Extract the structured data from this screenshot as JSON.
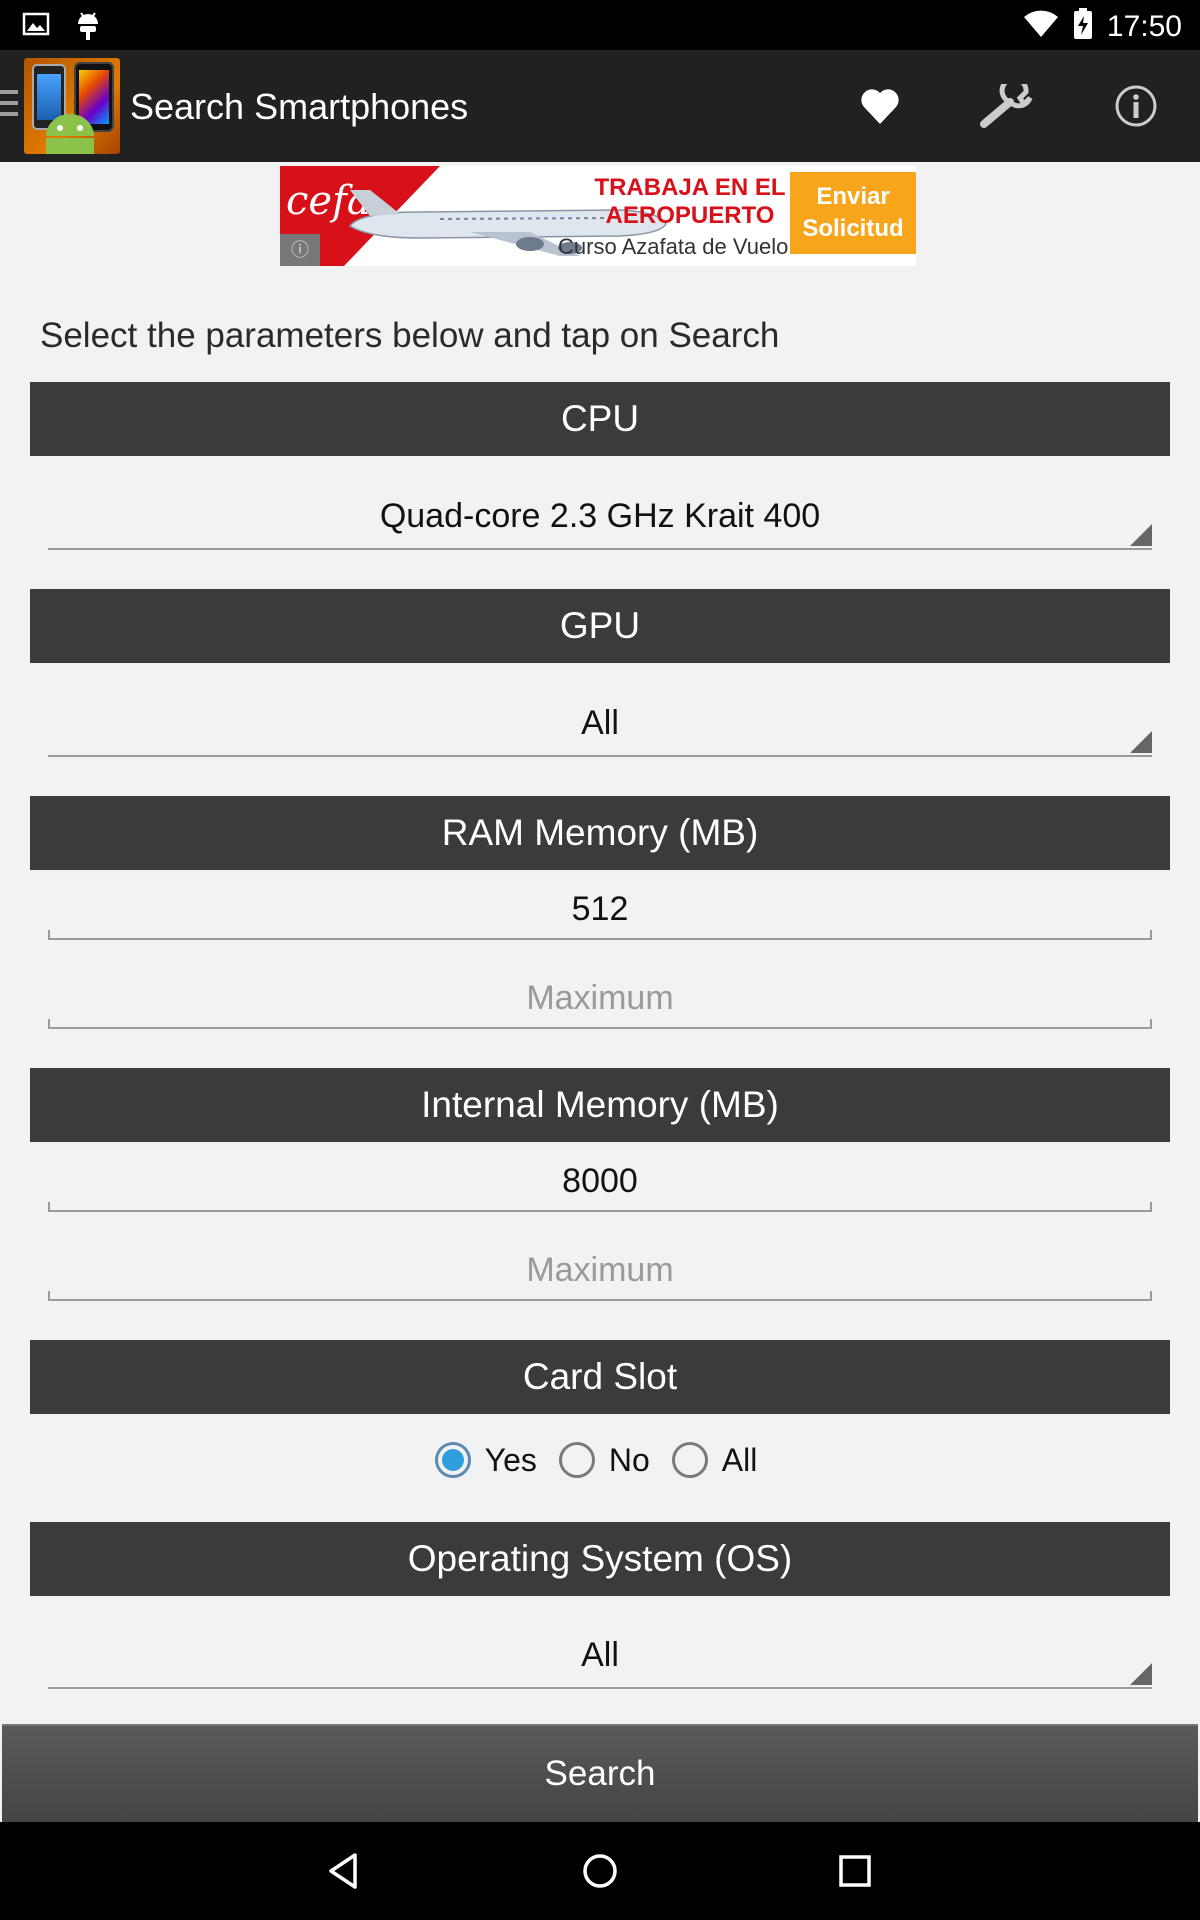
{
  "status_bar": {
    "time": "17:50"
  },
  "action_bar": {
    "title": "Search Smartphones"
  },
  "ad": {
    "logo": "cefa",
    "headline": "TRABAJA EN EL AEROPUERTO",
    "subtext": "Curso Azafata de Vuelo",
    "cta": "Enviar Solicitud"
  },
  "instructions": "Select the parameters below and tap on Search",
  "sections": {
    "cpu": {
      "title": "CPU",
      "selected": "Quad-core 2.3 GHz Krait 400"
    },
    "gpu": {
      "title": "GPU",
      "selected": "All"
    },
    "ram": {
      "title": "RAM Memory (MB)",
      "min_value": "512",
      "max_placeholder": "Maximum"
    },
    "internal": {
      "title": "Internal Memory (MB)",
      "min_value": "8000",
      "max_placeholder": "Maximum"
    },
    "card_slot": {
      "title": "Card Slot",
      "options": [
        "Yes",
        "No",
        "All"
      ],
      "selected": "Yes"
    },
    "os": {
      "title": "Operating System (OS)",
      "selected": "All"
    }
  },
  "search_button": "Search",
  "colors": {
    "header_bg": "#3b3b3b",
    "action_bar_bg": "#212121",
    "radio_accent": "#2e9fdc"
  }
}
